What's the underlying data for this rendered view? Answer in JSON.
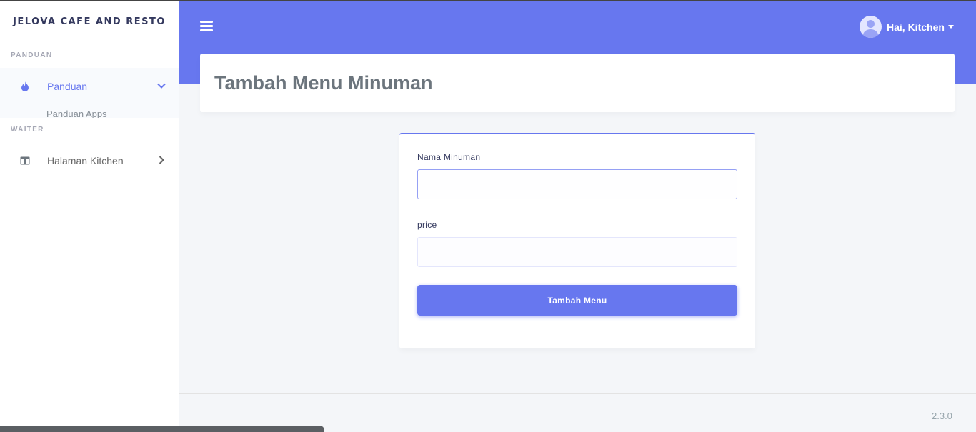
{
  "brand": "JELOVA CAFE AND RESTO",
  "sidebar": {
    "sections": [
      {
        "header": "PANDUAN",
        "item": {
          "label": "Panduan",
          "icon": "fire-icon",
          "state": "active-expanded"
        },
        "submenu": "Panduan Apps"
      },
      {
        "header": "WAITER",
        "item": {
          "label": "Halaman Kitchen",
          "icon": "columns-icon",
          "state": "collapsed"
        }
      }
    ]
  },
  "navbar": {
    "menu_icon": "hamburger-icon",
    "user_greeting": "Hai, Kitchen",
    "accent_color": "#6777ef"
  },
  "page": {
    "title": "Tambah Menu Minuman"
  },
  "form": {
    "name_label": "Nama Minuman",
    "name_value": "",
    "price_label": "price",
    "price_value": "",
    "submit_label": "Tambah Menu"
  },
  "footer": {
    "version": "2.3.0"
  }
}
